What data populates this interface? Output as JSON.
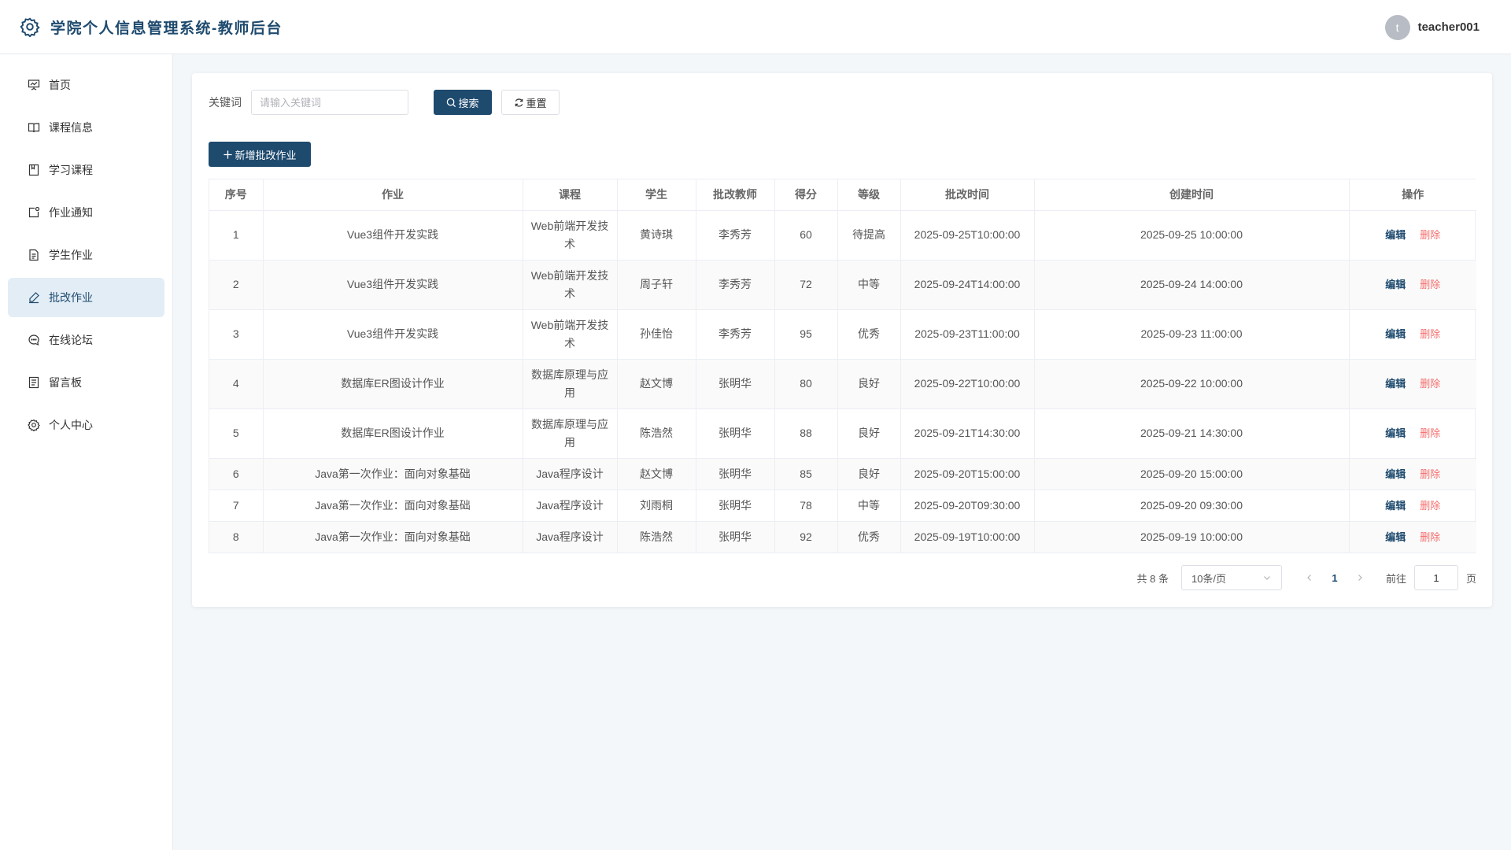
{
  "header": {
    "title": "学院个人信息管理系统-教师后台",
    "avatar_letter": "t",
    "username": "teacher001"
  },
  "sidebar": {
    "items": [
      {
        "label": "首页",
        "icon": "presentation-icon"
      },
      {
        "label": "课程信息",
        "icon": "book-open-icon"
      },
      {
        "label": "学习课程",
        "icon": "notebook-icon"
      },
      {
        "label": "作业通知",
        "icon": "notification-icon"
      },
      {
        "label": "学生作业",
        "icon": "document-icon"
      },
      {
        "label": "批改作业",
        "icon": "edit-pen-icon",
        "active": true
      },
      {
        "label": "在线论坛",
        "icon": "chat-dot-icon"
      },
      {
        "label": "留言板",
        "icon": "tickets-icon"
      },
      {
        "label": "个人中心",
        "icon": "setting-icon"
      }
    ]
  },
  "search": {
    "label": "关键词",
    "placeholder": "请输入关键词",
    "value": "",
    "search_label": "搜索",
    "reset_label": "重置"
  },
  "toolbar": {
    "add_label": "新增批改作业"
  },
  "table": {
    "columns": [
      "序号",
      "作业",
      "课程",
      "学生",
      "批改教师",
      "得分",
      "等级",
      "批改时间",
      "创建时间",
      "操作"
    ],
    "rows": [
      {
        "no": "1",
        "homework": "Vue3组件开发实践",
        "course": "Web前端开发技术",
        "student": "黄诗琪",
        "teacher": "李秀芳",
        "score": "60",
        "grade": "待提高",
        "review_time": "2025-09-25T10:00:00",
        "created": "2025-09-25 10:00:00"
      },
      {
        "no": "2",
        "homework": "Vue3组件开发实践",
        "course": "Web前端开发技术",
        "student": "周子轩",
        "teacher": "李秀芳",
        "score": "72",
        "grade": "中等",
        "review_time": "2025-09-24T14:00:00",
        "created": "2025-09-24 14:00:00"
      },
      {
        "no": "3",
        "homework": "Vue3组件开发实践",
        "course": "Web前端开发技术",
        "student": "孙佳怡",
        "teacher": "李秀芳",
        "score": "95",
        "grade": "优秀",
        "review_time": "2025-09-23T11:00:00",
        "created": "2025-09-23 11:00:00"
      },
      {
        "no": "4",
        "homework": "数据库ER图设计作业",
        "course": "数据库原理与应用",
        "student": "赵文博",
        "teacher": "张明华",
        "score": "80",
        "grade": "良好",
        "review_time": "2025-09-22T10:00:00",
        "created": "2025-09-22 10:00:00"
      },
      {
        "no": "5",
        "homework": "数据库ER图设计作业",
        "course": "数据库原理与应用",
        "student": "陈浩然",
        "teacher": "张明华",
        "score": "88",
        "grade": "良好",
        "review_time": "2025-09-21T14:30:00",
        "created": "2025-09-21 14:30:00"
      },
      {
        "no": "6",
        "homework": "Java第一次作业：面向对象基础",
        "course": "Java程序设计",
        "student": "赵文博",
        "teacher": "张明华",
        "score": "85",
        "grade": "良好",
        "review_time": "2025-09-20T15:00:00",
        "created": "2025-09-20 15:00:00"
      },
      {
        "no": "7",
        "homework": "Java第一次作业：面向对象基础",
        "course": "Java程序设计",
        "student": "刘雨桐",
        "teacher": "张明华",
        "score": "78",
        "grade": "中等",
        "review_time": "2025-09-20T09:30:00",
        "created": "2025-09-20 09:30:00"
      },
      {
        "no": "8",
        "homework": "Java第一次作业：面向对象基础",
        "course": "Java程序设计",
        "student": "陈浩然",
        "teacher": "张明华",
        "score": "92",
        "grade": "优秀",
        "review_time": "2025-09-19T10:00:00",
        "created": "2025-09-19 10:00:00"
      }
    ],
    "edit_label": "编辑",
    "delete_label": "删除"
  },
  "pagination": {
    "total_text": "共 8 条",
    "page_size": "10条/页",
    "current_page": "1",
    "goto_label": "前往",
    "goto_value": "1",
    "goto_suffix": "页"
  },
  "colors": {
    "primary": "#1e4a6e",
    "danger": "#f56c6c",
    "active_bg": "#e3edf6"
  }
}
